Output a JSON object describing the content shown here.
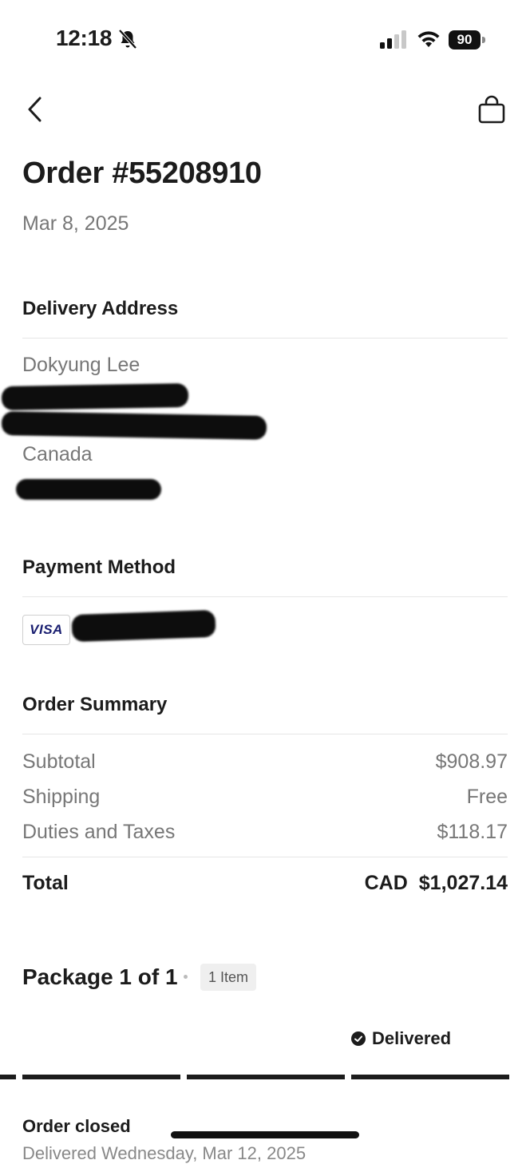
{
  "status_bar": {
    "time": "12:18",
    "battery": "90"
  },
  "order": {
    "title": "Order #55208910",
    "date": "Mar 8, 2025"
  },
  "delivery": {
    "heading": "Delivery Address",
    "name": "Dokyung Lee",
    "country": "Canada"
  },
  "payment": {
    "heading": "Payment Method",
    "card_brand": "VISA"
  },
  "summary": {
    "heading": "Order Summary",
    "rows": [
      {
        "label": "Subtotal",
        "value": "$908.97"
      },
      {
        "label": "Shipping",
        "value": "Free"
      },
      {
        "label": "Duties and Taxes",
        "value": "$118.17"
      }
    ],
    "total_label": "Total",
    "total_currency": "CAD",
    "total_value": "$1,027.14"
  },
  "package": {
    "title": "Package 1 of 1",
    "item_count": "1 Item",
    "status": "Delivered",
    "progress_steps_completed": 4,
    "progress_steps_total": 4,
    "order_status": "Order closed",
    "delivered_note": "Delivered Wednesday, Mar 12, 2025"
  },
  "icons": [
    "bell-slash-icon",
    "signal-icon",
    "wifi-icon",
    "battery-icon",
    "back-chevron-icon",
    "shopping-bag-icon",
    "check-circle-icon"
  ]
}
